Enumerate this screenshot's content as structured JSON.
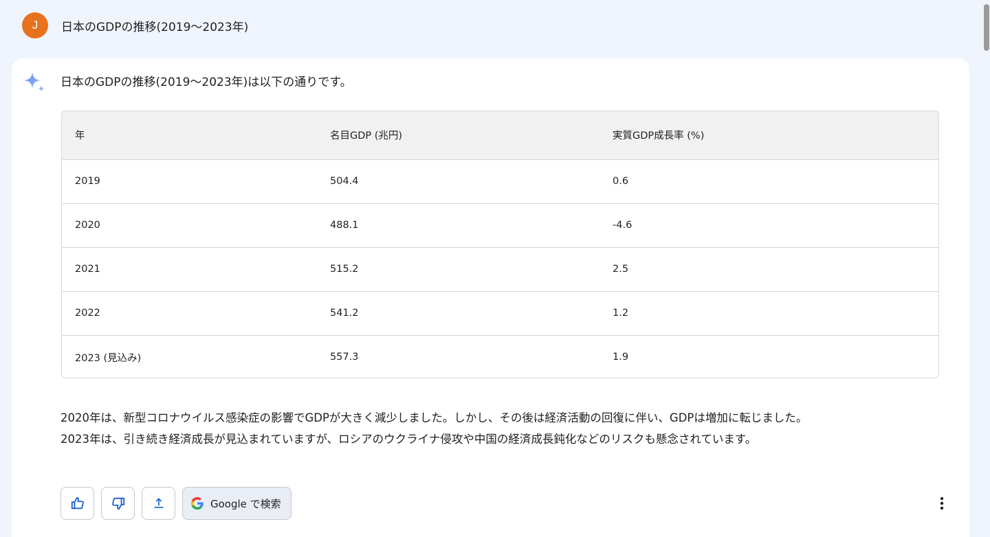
{
  "prompt": {
    "avatar_initial": "J",
    "text": "日本のGDPの推移(2019～2023年)"
  },
  "response": {
    "sparkle_icon": "gemini-sparkle-icon",
    "intro": "日本のGDPの推移(2019～2023年)は以下の通りです。",
    "table": {
      "headers": [
        "年",
        "名目GDP (兆円)",
        "実質GDP成長率 (%)"
      ],
      "rows": [
        [
          "2019",
          "504.4",
          "0.6"
        ],
        [
          "2020",
          "488.1",
          "-4.6"
        ],
        [
          "2021",
          "515.2",
          "2.5"
        ],
        [
          "2022",
          "541.2",
          "1.2"
        ],
        [
          "2023 (見込み)",
          "557.3",
          "1.9"
        ]
      ]
    },
    "summary_lines": [
      "2020年は、新型コロナウイルス感染症の影響でGDPが大きく減少しました。しかし、その後は経済活動の回復に伴い、GDPは増加に転じました。",
      "2023年は、引き続き経済成長が見込まれていますが、ロシアのウクライナ侵攻や中国の経済成長鈍化などのリスクも懸念されています。"
    ]
  },
  "actions": {
    "thumbs_up_icon": "thumbs-up-icon",
    "thumbs_down_icon": "thumbs-down-icon",
    "share_icon": "share-icon",
    "google_search_label": "Google で検索",
    "more_icon": "more-vert-icon"
  },
  "colors": {
    "background": "#f0f4fc",
    "avatar": "#e8711e",
    "accent_blue": "#4285f4"
  }
}
